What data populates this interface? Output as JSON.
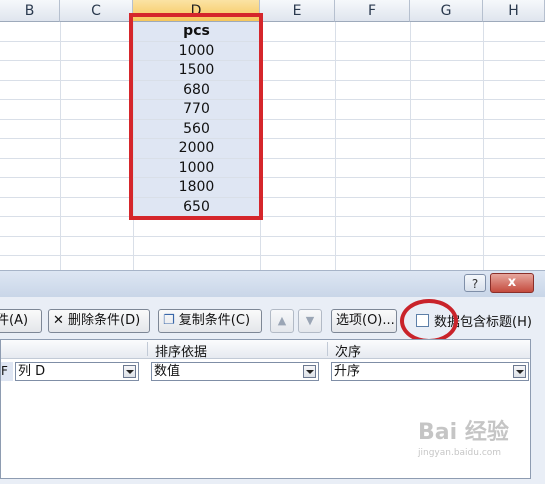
{
  "spreadsheet": {
    "columns": [
      "B",
      "C",
      "D",
      "E",
      "F",
      "G",
      "H"
    ],
    "selected_column": "D",
    "column_d_values": [
      "pcs",
      "1000",
      "1500",
      "680",
      "770",
      "560",
      "2000",
      "1000",
      "1800",
      "650"
    ],
    "annotation_color": "#d5262b"
  },
  "dialog": {
    "help_label": "?",
    "close_label": "x",
    "buttons": {
      "add_condition": "条件(A)",
      "delete_condition": "删除条件(D)",
      "copy_condition": "复制条件(C)",
      "options": "选项(O)..."
    },
    "move_up_icon": "up-arrow-icon",
    "move_down_icon": "down-arrow-icon",
    "has_headers_label": "数据包含标题(H)",
    "has_headers_checked": false,
    "list_headers": {
      "sort_on": "排序依据",
      "order": "次序"
    },
    "row": {
      "prefix": "F",
      "column": "列 D",
      "sort_on": "数值",
      "order": "升序"
    }
  },
  "watermark": {
    "brand": "Bai 经验",
    "url": "jingyan.baidu.com"
  }
}
